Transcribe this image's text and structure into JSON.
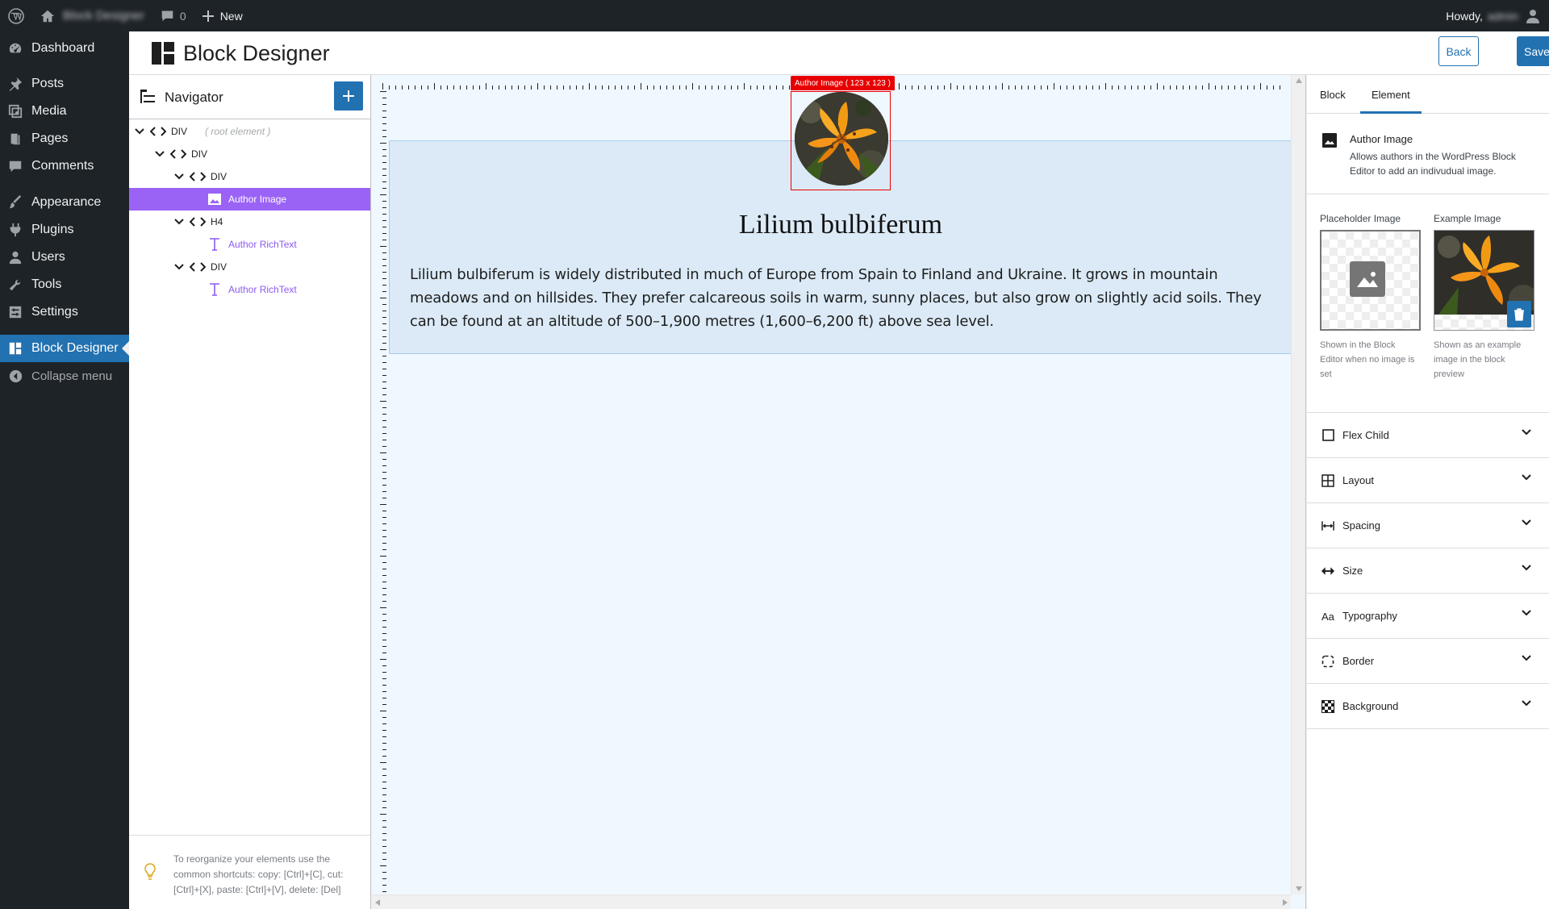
{
  "adminbar": {
    "site_name": "Block Designer",
    "comments_count": "0",
    "new_label": "New",
    "howdy_label": "Howdy,",
    "user_name": "admin"
  },
  "adminmenu": {
    "items": [
      {
        "label": "Dashboard",
        "icon": "dashboard-icon"
      },
      {
        "label": "Posts",
        "icon": "pin-icon"
      },
      {
        "label": "Media",
        "icon": "media-icon"
      },
      {
        "label": "Pages",
        "icon": "page-icon"
      },
      {
        "label": "Comments",
        "icon": "comment-icon"
      },
      {
        "label": "Appearance",
        "icon": "brush-icon"
      },
      {
        "label": "Plugins",
        "icon": "plugin-icon"
      },
      {
        "label": "Users",
        "icon": "user-icon"
      },
      {
        "label": "Tools",
        "icon": "wrench-icon"
      },
      {
        "label": "Settings",
        "icon": "settings-icon"
      },
      {
        "label": "Block Designer",
        "icon": "block-designer-icon"
      }
    ],
    "collapse_label": "Collapse menu"
  },
  "header": {
    "title": "Block Designer",
    "back_label": "Back",
    "save_label": "Save"
  },
  "navigator": {
    "title": "Navigator",
    "add_label": "+",
    "tree": [
      {
        "tag": "DIV",
        "note": "( root element )"
      },
      {
        "tag": "DIV"
      },
      {
        "tag": "DIV"
      },
      {
        "label": "Author Image",
        "selected": true
      },
      {
        "tag": "H4"
      },
      {
        "label": "Author RichText"
      },
      {
        "tag": "DIV"
      },
      {
        "label": "Author RichText"
      }
    ],
    "tip": "To reorganize your elements use the common shortcuts: copy: [Ctrl]+[C], cut: [Ctrl]+[X], paste: [Ctrl]+[V], delete: [Del]"
  },
  "canvas": {
    "image_tag": "Author Image ( 123 x 123 )",
    "title": "Lilium bulbiferum",
    "text": "Lilium bulbiferum is widely distributed in much of Europe from Spain to Finland and Ukraine. It grows in mountain meadows and on hillsides. They prefer calcareous soils in warm, sunny places, but also grow on slightly acid soils. They can be found at an altitude of 500–1,900 metres (1,600–6,200 ft) above sea level."
  },
  "sidebar": {
    "tabs": [
      "Block",
      "Element"
    ],
    "active_tab": "Element",
    "element_title": "Author Image",
    "element_desc": "Allows authors in the WordPress Block Editor to add an indivudual image.",
    "placeholder_label": "Placeholder Image",
    "placeholder_desc": "Shown in the Block Editor when no image is set",
    "example_label": "Example Image",
    "example_desc": "Shown as an example image in the block preview",
    "panels": [
      {
        "label": "Flex Child",
        "icon": "checkbox-icon"
      },
      {
        "label": "Layout",
        "icon": "grid-icon"
      },
      {
        "label": "Spacing",
        "icon": "spacing-icon"
      },
      {
        "label": "Size",
        "icon": "resize-icon"
      },
      {
        "label": "Typography",
        "icon": "typography-icon"
      },
      {
        "label": "Border",
        "icon": "border-icon"
      },
      {
        "label": "Background",
        "icon": "background-icon"
      }
    ]
  },
  "colors": {
    "accent": "#2271b1",
    "selection": "#9b63f5",
    "canvas_bg": "#f0f8ff",
    "card_bg": "#dbeaf6",
    "image_outline": "#e80000"
  }
}
